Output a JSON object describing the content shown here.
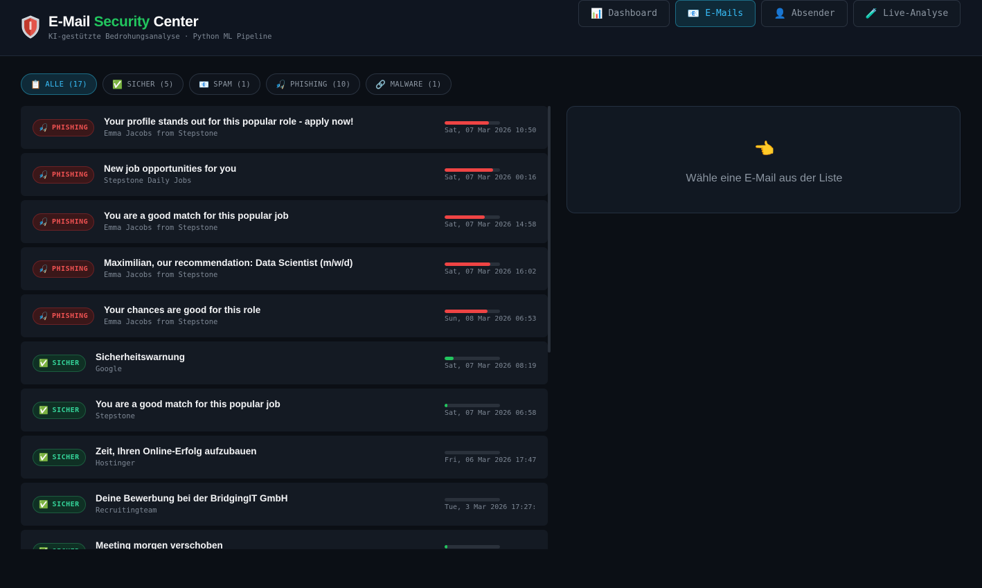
{
  "header": {
    "title_prefix": "E-Mail",
    "title_accent": "Security",
    "title_suffix": "Center",
    "subtitle": "KI-gestützte Bedrohungsanalyse · Python ML Pipeline",
    "logo_icon": "shield-icon"
  },
  "nav": [
    {
      "icon": "📊",
      "label": "Dashboard",
      "active": false
    },
    {
      "icon": "📧",
      "label": "E-Mails",
      "active": true
    },
    {
      "icon": "👤",
      "label": "Absender",
      "active": false
    },
    {
      "icon": "🧪",
      "label": "Live-Analyse",
      "active": false
    }
  ],
  "filters": [
    {
      "icon": "📋",
      "label": "ALLE (17)",
      "active": true
    },
    {
      "icon": "✅",
      "label": "SICHER (5)",
      "active": false
    },
    {
      "icon": "📧",
      "label": "SPAM (1)",
      "active": false
    },
    {
      "icon": "🎣",
      "label": "PHISHING (10)",
      "active": false
    },
    {
      "icon": "🔗",
      "label": "MALWARE (1)",
      "active": false
    }
  ],
  "emails": [
    {
      "category": "phishing",
      "badge_icon": "🎣",
      "badge": "PHISHING",
      "subject": "Your profile stands out for this popular role - apply now!",
      "sender": "Emma Jacobs from Stepstone",
      "date": "Sat, 07 Mar 2026 10:50",
      "risk": 0.8
    },
    {
      "category": "phishing",
      "badge_icon": "🎣",
      "badge": "PHISHING",
      "subject": "New job opportunities for you",
      "sender": "Stepstone Daily Jobs",
      "date": "Sat, 07 Mar 2026 00:16",
      "risk": 0.88
    },
    {
      "category": "phishing",
      "badge_icon": "🎣",
      "badge": "PHISHING",
      "subject": "You are a good match for this popular job",
      "sender": "Emma Jacobs from Stepstone",
      "date": "Sat, 07 Mar 2026 14:58",
      "risk": 0.72
    },
    {
      "category": "phishing",
      "badge_icon": "🎣",
      "badge": "PHISHING",
      "subject": "Maximilian, our recommendation: Data Scientist (m/w/d)",
      "sender": "Emma Jacobs from Stepstone",
      "date": "Sat, 07 Mar 2026 16:02",
      "risk": 0.83
    },
    {
      "category": "phishing",
      "badge_icon": "🎣",
      "badge": "PHISHING",
      "subject": "Your chances are good for this role",
      "sender": "Emma Jacobs from Stepstone",
      "date": "Sun, 08 Mar 2026 06:53",
      "risk": 0.78
    },
    {
      "category": "sicher",
      "badge_icon": "✅",
      "badge": "SICHER",
      "subject": "Sicherheitswarnung",
      "sender": "Google",
      "date": "Sat, 07 Mar 2026 08:19",
      "risk": 0.16
    },
    {
      "category": "sicher",
      "badge_icon": "✅",
      "badge": "SICHER",
      "subject": "You are a good match for this popular job",
      "sender": "Stepstone",
      "date": "Sat, 07 Mar 2026 06:58",
      "risk": 0.05
    },
    {
      "category": "sicher",
      "badge_icon": "✅",
      "badge": "SICHER",
      "subject": "Zeit, Ihren Online-Erfolg aufzubauen",
      "sender": "Hostinger",
      "date": "Fri, 06 Mar 2026 17:47",
      "risk": 0
    },
    {
      "category": "sicher",
      "badge_icon": "✅",
      "badge": "SICHER",
      "subject": "Deine Bewerbung bei der BridgingIT GmbH",
      "sender": "Recruitingteam",
      "date": "Tue, 3 Mar 2026 17:27:",
      "risk": 0
    },
    {
      "category": "sicher",
      "badge_icon": "✅",
      "badge": "SICHER",
      "subject": "Meeting morgen verschoben",
      "sender": "",
      "date": "",
      "risk": 0.05
    }
  ],
  "detail": {
    "icon": "👈",
    "hint": "Wähle eine E-Mail aus der Liste"
  },
  "colors": {
    "phishing_bar": "#ef4444",
    "sicher_bar": "#22c55e",
    "accent": "#38bdf8"
  }
}
